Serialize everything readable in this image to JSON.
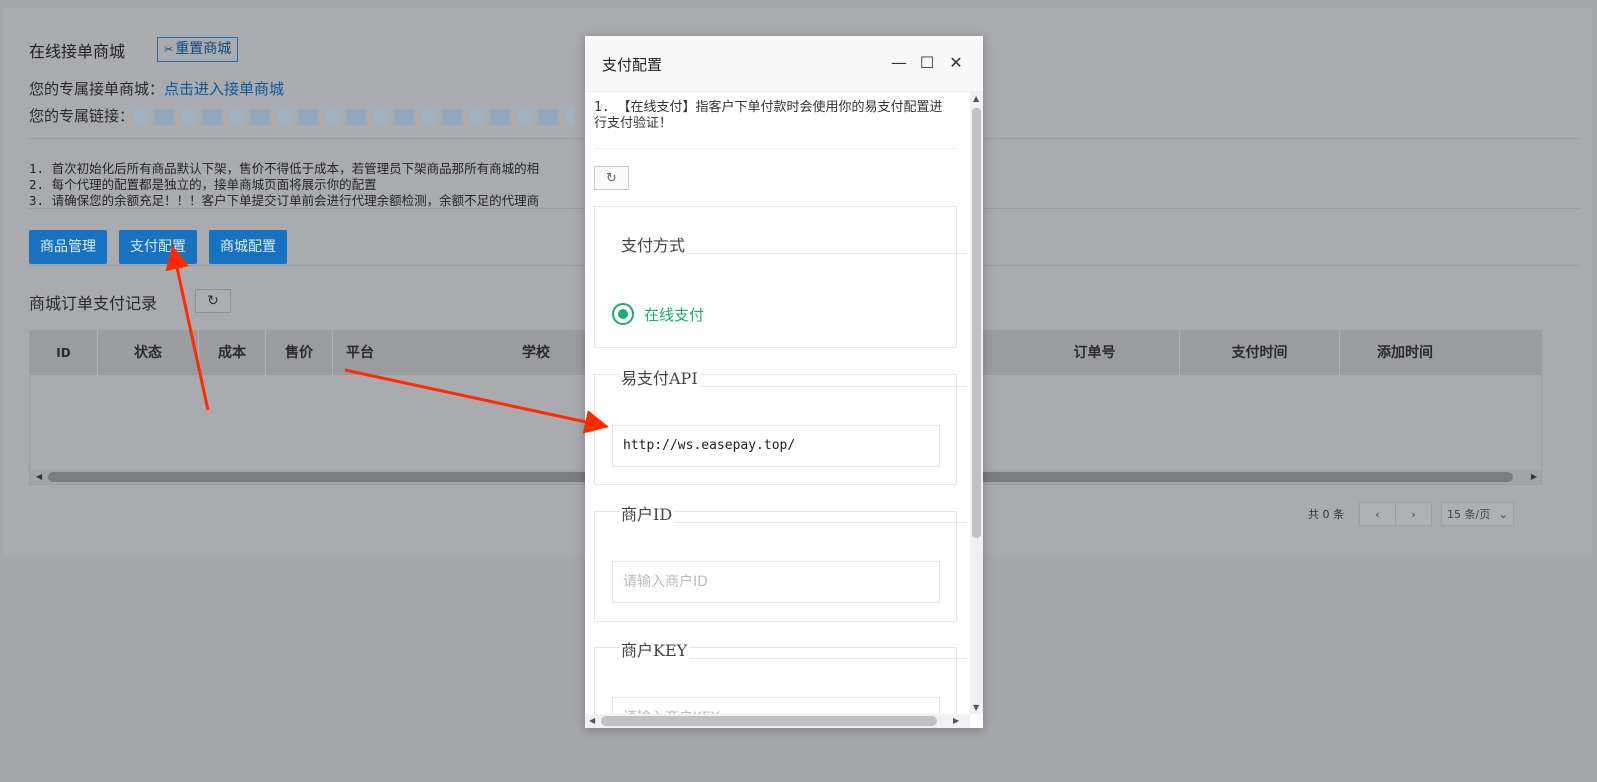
{
  "page": {
    "title": "在线接单商城",
    "reset_label": "重置商城",
    "mall_prefix": "您的专属接单商城：",
    "mall_link": "点击进入接单商城",
    "link_prefix": "您的专属链接：",
    "notes": [
      "1. 首次初始化后所有商品默认下架，售价不得低于成本，若管理员下架商品那所有商城的相",
      "2. 每个代理的配置都是独立的，接单商城页面将展示你的配置",
      "3. 请确保您的余额充足！！！客户下单提交订单前会进行代理余额检测，余额不足的代理商"
    ],
    "buttons": {
      "goods": "商品管理",
      "payment": "支付配置",
      "mall": "商城配置"
    },
    "records_title": "商城订单支付记录",
    "refresh_icon": "refresh-icon",
    "table_headers": [
      "ID",
      "状态",
      "成本",
      "售价",
      "平台",
      "学校",
      "订单号",
      "支付时间",
      "添加时间"
    ],
    "pager": {
      "total": "共 0 条",
      "page_size": "15 条/页"
    }
  },
  "modal": {
    "title": "支付配置",
    "tip": "1. 【在线支付】指客户下单付款时会使用你的易支付配置进行支付验证！",
    "sections": {
      "method_legend": "支付方式",
      "method_option": "在线支付",
      "api_legend": "易支付API",
      "api_value": "http://ws.easepay.top/",
      "merchant_id_legend": "商户ID",
      "merchant_id_placeholder": "请输入商户ID",
      "merchant_key_legend": "商户KEY",
      "merchant_key_placeholder": "请输入商户KEY"
    }
  },
  "colors": {
    "primary": "#1773c2",
    "success": "#1aad6f",
    "annotation": "#ff2a00"
  }
}
